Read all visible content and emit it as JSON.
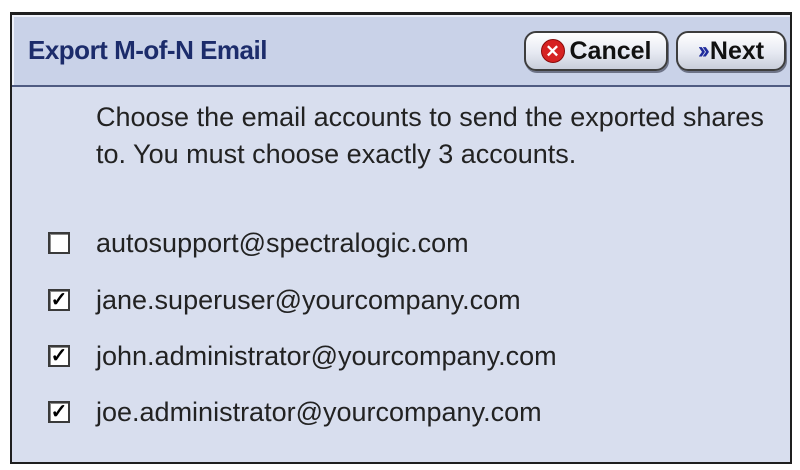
{
  "dialog": {
    "title": "Export M-of-N Email",
    "cancel_label": "Cancel",
    "next_label": "Next",
    "instructions": "Choose the email accounts to send the exported shares to. You must choose exactly 3 accounts."
  },
  "accounts": [
    {
      "email": "autosupport@spectralogic.com",
      "checked": false,
      "mark": ""
    },
    {
      "email": "jane.superuser@yourcompany.com",
      "checked": true,
      "mark": "✓"
    },
    {
      "email": "john.administrator@yourcompany.com",
      "checked": true,
      "mark": "✓"
    },
    {
      "email": "joe.administrator@yourcompany.com",
      "checked": true,
      "mark": "✓"
    }
  ],
  "icons": {
    "cancel": "cancel-x-icon",
    "next": "double-chevron-right-icon"
  },
  "colors": {
    "title_text": "#1c2c6b",
    "panel_bg": "#d8deee",
    "cancel_icon": "#d62222",
    "next_icon": "#1f2b9c"
  }
}
